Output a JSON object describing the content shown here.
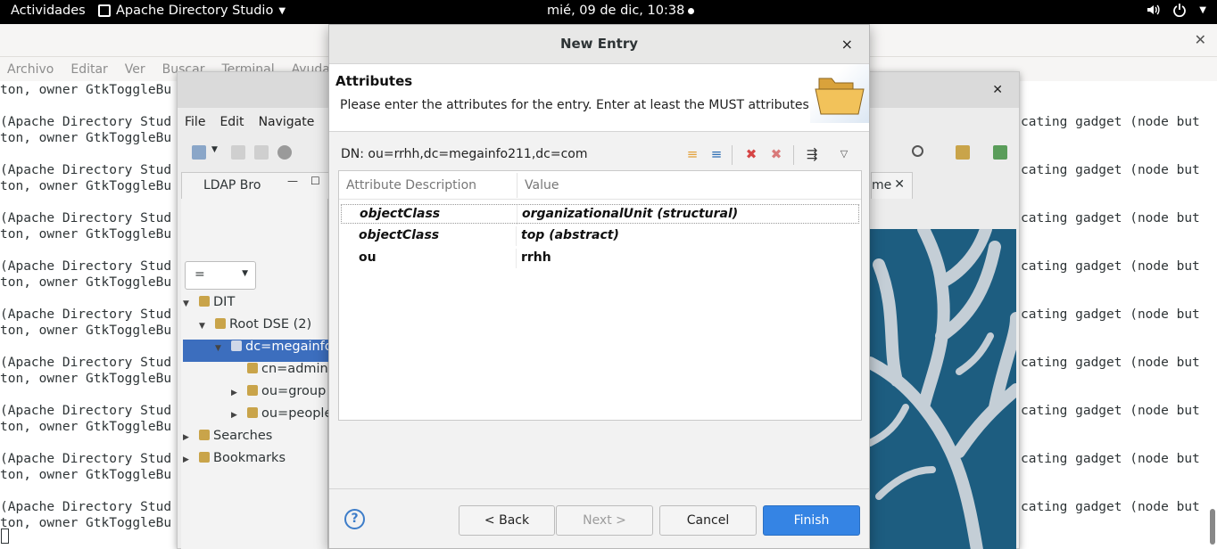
{
  "topbar": {
    "activities": "Actividades",
    "app_name": "Apache Directory Studio",
    "clock": "mié, 09 de dic, 10:38",
    "icons": [
      "volume-icon",
      "power-icon",
      "system-menu-caret-icon"
    ]
  },
  "terminal": {
    "menu": [
      "Archivo",
      "Editar",
      "Ver",
      "Buscar",
      "Terminal",
      "Ayuda"
    ],
    "left_lines": [
      "ton, owner GtkToggleBu",
      "",
      "(Apache Directory Stud",
      "ton, owner GtkToggleBu",
      "",
      "(Apache Directory Stud",
      "ton, owner GtkToggleBu",
      "",
      "(Apache Directory Stud",
      "ton, owner GtkToggleBu",
      "",
      "(Apache Directory Stud",
      "ton, owner GtkToggleBu",
      "",
      "(Apache Directory Stud",
      "ton, owner GtkToggleBu",
      "",
      "(Apache Directory Stud",
      "ton, owner GtkToggleBu",
      "",
      "(Apache Directory Stud",
      "ton, owner GtkToggleBu",
      "",
      "(Apache Directory Stud",
      "ton, owner GtkToggleBu",
      "",
      "(Apache Directory Stud",
      "ton, owner GtkToggleBu"
    ],
    "right_text": "cating gadget (node but"
  },
  "ads": {
    "menu": [
      "File",
      "Edit",
      "Navigate"
    ],
    "tab_label": "LDAP Bro",
    "filter_value": "=",
    "right_tab_label": "me",
    "tree": [
      {
        "label": "DIT",
        "arrow": "▼",
        "level": 0
      },
      {
        "label": "Root DSE (2)",
        "arrow": "▼",
        "level": 1
      },
      {
        "label": "dc=megainfo2",
        "arrow": "▼",
        "level": 2,
        "selected": true
      },
      {
        "label": "cn=admin",
        "arrow": "",
        "level": 3
      },
      {
        "label": "ou=group (",
        "arrow": "▶",
        "level": 3
      },
      {
        "label": "ou=people",
        "arrow": "▶",
        "level": 3
      },
      {
        "label": "Searches",
        "arrow": "▶",
        "level": 0
      },
      {
        "label": "Bookmarks",
        "arrow": "▶",
        "level": 0
      }
    ]
  },
  "dialog": {
    "title": "New Entry",
    "close": "×",
    "banner_title": "Attributes",
    "banner_desc": "Please enter the attributes for the entry. Enter at least the MUST attributes.",
    "dn": "DN: ou=rrhh,dc=megainfo211,dc=com",
    "columns": [
      "Attribute Description",
      "Value"
    ],
    "rows": [
      {
        "attr": "objectClass",
        "value": "organizationalUnit (structural)",
        "must": true,
        "selected": true
      },
      {
        "attr": "objectClass",
        "value": "top (abstract)",
        "must": true,
        "selected": false
      },
      {
        "attr": "ou",
        "value": "rrhh",
        "must": false,
        "selected": false
      }
    ],
    "buttons": {
      "help": "?",
      "back": "< Back",
      "next": "Next >",
      "cancel": "Cancel",
      "finish": "Finish"
    }
  }
}
